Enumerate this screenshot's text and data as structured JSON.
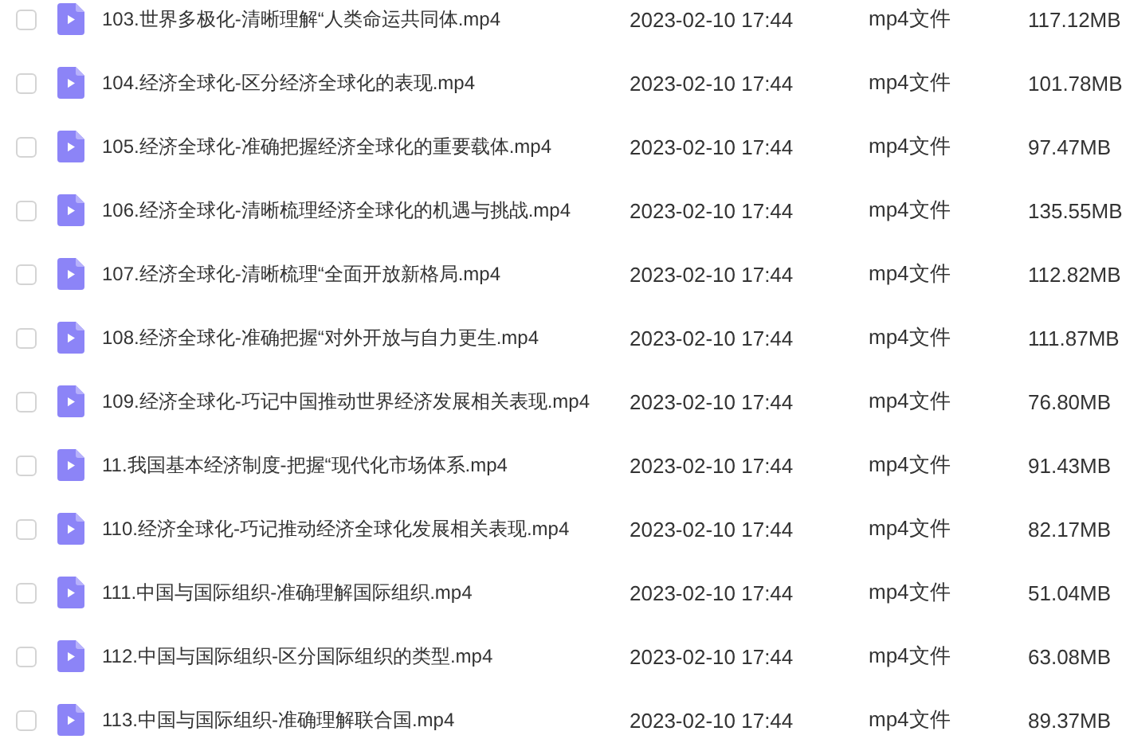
{
  "files": [
    {
      "checked": false,
      "name": "103.世界多极化-清晰理解“人类命运共同体.mp4",
      "modified": "2023-02-10 17:44",
      "type": "mp4文件",
      "size": "117.12MB"
    },
    {
      "checked": false,
      "name": "104.经济全球化-区分经济全球化的表现.mp4",
      "modified": "2023-02-10 17:44",
      "type": "mp4文件",
      "size": "101.78MB"
    },
    {
      "checked": false,
      "name": "105.经济全球化-准确把握经济全球化的重要载体.mp4",
      "modified": "2023-02-10 17:44",
      "type": "mp4文件",
      "size": "97.47MB"
    },
    {
      "checked": false,
      "name": "106.经济全球化-清晰梳理经济全球化的机遇与挑战.mp4",
      "modified": "2023-02-10 17:44",
      "type": "mp4文件",
      "size": "135.55MB"
    },
    {
      "checked": false,
      "name": "107.经济全球化-清晰梳理“全面开放新格局.mp4",
      "modified": "2023-02-10 17:44",
      "type": "mp4文件",
      "size": "112.82MB"
    },
    {
      "checked": false,
      "name": "108.经济全球化-准确把握“对外开放与自力更生.mp4",
      "modified": "2023-02-10 17:44",
      "type": "mp4文件",
      "size": "111.87MB"
    },
    {
      "checked": false,
      "name": "109.经济全球化-巧记中国推动世界经济发展相关表现.mp4",
      "modified": "2023-02-10 17:44",
      "type": "mp4文件",
      "size": "76.80MB"
    },
    {
      "checked": false,
      "name": "11.我国基本经济制度-把握“现代化市场体系.mp4",
      "modified": "2023-02-10 17:44",
      "type": "mp4文件",
      "size": "91.43MB"
    },
    {
      "checked": false,
      "name": "110.经济全球化-巧记推动经济全球化发展相关表现.mp4",
      "modified": "2023-02-10 17:44",
      "type": "mp4文件",
      "size": "82.17MB"
    },
    {
      "checked": false,
      "name": "111.中国与国际组织-准确理解国际组织.mp4",
      "modified": "2023-02-10 17:44",
      "type": "mp4文件",
      "size": "51.04MB"
    },
    {
      "checked": false,
      "name": "112.中国与国际组织-区分国际组织的类型.mp4",
      "modified": "2023-02-10 17:44",
      "type": "mp4文件",
      "size": "63.08MB"
    },
    {
      "checked": false,
      "name": "113.中国与国际组织-准确理解联合国.mp4",
      "modified": "2023-02-10 17:44",
      "type": "mp4文件",
      "size": "89.37MB"
    }
  ]
}
